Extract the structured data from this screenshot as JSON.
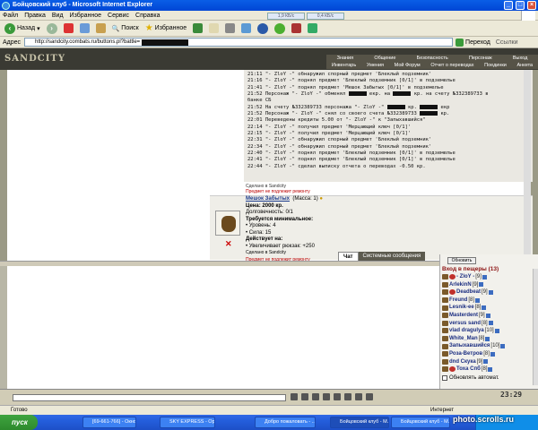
{
  "window": {
    "title": "Бойцовский клуб - Microsoft Internet Explorer",
    "minimize_icon": "minimize-icon",
    "maximize_icon": "maximize-icon",
    "close_icon": "close-icon"
  },
  "menu": {
    "items": [
      "Файл",
      "Правка",
      "Вид",
      "Избранное",
      "Сервис",
      "Справка"
    ],
    "speed_down": "1,9 КБ/с",
    "speed_up": "0,4 КБ/с"
  },
  "toolbar": {
    "back_label": "Назад",
    "search_label": "Поиск",
    "favorites_label": "Избранное"
  },
  "address": {
    "label": "Адрес",
    "url": "http://sandcity.combats.ru/buttons.pl?battle=",
    "go_label": "Переход",
    "links_label": "Ссылки"
  },
  "site": {
    "logo": "SANDCITY",
    "nav_top": [
      "Знания",
      "Общение",
      "Безопасность",
      "Персонаж",
      "Выход"
    ],
    "nav_bottom": [
      "Инвентарь",
      "Умения",
      "Мой Форум",
      "Отчет о переводах",
      "Поединки",
      "Анкета"
    ]
  },
  "log": {
    "lines": [
      {
        "t": "21:11",
        "text": " \"- ZloY -\" обнаружил спорный предмет 'Блеклый подземник'",
        "redact": false
      },
      {
        "t": "21:16",
        "text": " \"- ZloY -\" поднял предмет 'Блеклый подземник [0/1]' в подземелье",
        "redact": false
      },
      {
        "t": "21:41",
        "text": " \"- ZloY -\" поднял предмет 'Мешок Забытых [0/1]' в подземелье",
        "redact": false
      },
      {
        "t": "21:52",
        "text": " Персонаж \"- ZloY -\" обменял ▇▇ екр. на ▇▇ кр. на счету №332389733 в",
        "redact": true
      },
      {
        "t": "",
        "text": "банке СБ",
        "redact": false
      },
      {
        "t": "21:52",
        "text": " На счету №332389733 персонажа \"- ZloY -\" ▇▇ кр. ▇▇ екр",
        "redact": true
      },
      {
        "t": "21:52",
        "text": " Персонаж \"- ZloY -\" снял со своего счета №332389733 ▇▇ кр.",
        "redact": true
      },
      {
        "t": "22:01",
        "text": " Переведены кредиты 5.00 от \"- ZloY -\" к \"Запыхавшийся\"",
        "redact": false
      },
      {
        "t": "22:14",
        "text": " \"- ZloY -\" получил предмет 'Мерцающий ключ [0/1]'",
        "redact": false
      },
      {
        "t": "22:15",
        "text": " \"- ZloY -\" получил предмет 'Мерцающий ключ [0/1]'",
        "redact": false
      },
      {
        "t": "22:31",
        "text": " \"- ZloY -\" обнаружил спорный предмет 'Блеклый подземник'",
        "redact": false
      },
      {
        "t": "22:34",
        "text": " \"- ZloY -\" обнаружил спорный предмет 'Блеклый подземник'",
        "redact": false
      },
      {
        "t": "22:40",
        "text": " \"- ZloY -\" поднял предмет 'Блеклый подземник [0/1]' в подземелье",
        "redact": false
      },
      {
        "t": "22:41",
        "text": " \"- ZloY -\" поднял предмет 'Блеклый подземник [0/1]' в подземелье",
        "redact": false
      },
      {
        "t": "22:44",
        "text": " \"- ZloY -\" сделал выписку отчета о переводах -0.50 кр.",
        "redact": false
      }
    ],
    "made_in": "Сделано в Sandcity",
    "repair": "Предмет не подлежит ремонту"
  },
  "item": {
    "name": "Мешок Забытых",
    "mass": "(Масса: 1)",
    "price": "Цена: 2000 кр.",
    "durability": "Долговечность: 0/1",
    "req_title": "Требуется минимальное:",
    "req_level": "• Уровень: 4",
    "req_strength": "• Сила: 15",
    "effect_title": "Действует на:",
    "effect": "• Увеличивает рюкзак: +250",
    "made_in": "Сделано в Sandcity",
    "repair": "Предмет не подлежит ремонту"
  },
  "chat": {
    "tabs": [
      "Чат",
      "Системные сообщения"
    ]
  },
  "room": {
    "refresh_label": "Обновить",
    "title": "Вход в пещеры (13)",
    "users": [
      {
        "name": "- ZloY -",
        "level": "[9]",
        "red": true
      },
      {
        "name": "ArlekinN",
        "level": "[9]",
        "red": false
      },
      {
        "name": "Deadbeat",
        "level": "[9]",
        "red": true
      },
      {
        "name": "Freund",
        "level": "[8]",
        "red": false
      },
      {
        "name": "Lesnik-ee",
        "level": "[8]",
        "red": false
      },
      {
        "name": "Masterdent",
        "level": "[9]",
        "red": false
      },
      {
        "name": "versus sand",
        "level": "[8]",
        "red": false
      },
      {
        "name": "vlad dragulya",
        "level": "[10]",
        "red": false
      },
      {
        "name": "White_Man",
        "level": "[8]",
        "red": false
      },
      {
        "name": "Запыхавшийся",
        "level": "[10]",
        "red": false
      },
      {
        "name": "Роза-Ветров",
        "level": "[8]",
        "red": false
      },
      {
        "name": "dnd Скука",
        "level": "[9]",
        "red": false
      },
      {
        "name": "Тоха Спб",
        "level": "[8]",
        "red": true
      }
    ],
    "auto_label": "Обновлять автомат."
  },
  "clock": "23:29",
  "status": {
    "left": "Готово",
    "zone": "Интернет"
  },
  "taskbar": {
    "start": "пуск",
    "tasks": [
      "[69-661-766] - Окно ...",
      "SKY EXPRESS - Opera",
      "Добро пожаловать - ...",
      "Бойцовский клуб - M...",
      "Бойцовский клуб - M..."
    ]
  },
  "watermark": "photo.scrolls.ru",
  "colors": {
    "xp_blue": "#0046d5",
    "header": "#3a3a33",
    "room_title": "#8b1010",
    "nick": "#1a2d80"
  }
}
